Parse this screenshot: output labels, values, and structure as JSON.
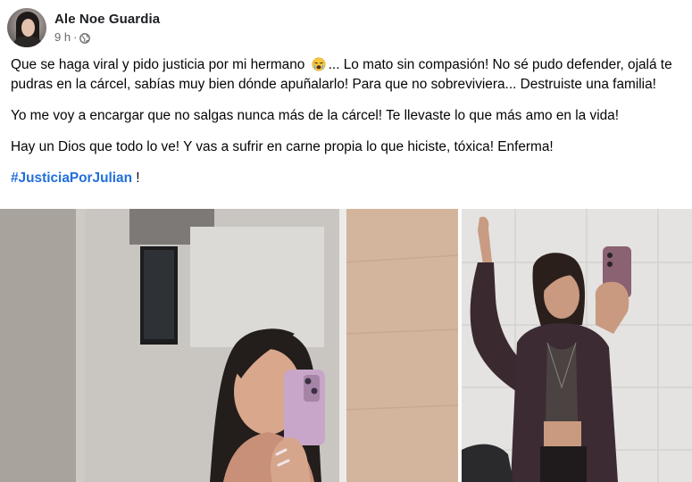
{
  "post": {
    "author": "Ale Noe Guardia",
    "time": "9 h",
    "separator": "·",
    "privacy_icon": "globe-icon",
    "paragraphs": [
      {
        "before_emoji": "Que se haga viral y pido justicia por mi hermano ",
        "emoji": "crying-face-emoji",
        "after_emoji": "... Lo mato sin compasión! No sé pudo defender, ojalá te pudras en la cárcel, sabías muy bien dónde apuñalarlo! Para que no sobreviviera... Destruiste una familia!"
      },
      {
        "text": "Yo me voy a encargar que no salgas nunca más de la cárcel! Te llevaste lo que más amo en la vida!"
      },
      {
        "text": "Hay un Dios que todo lo ve! Y vas a sufrir en carne propia lo que hiciste, tóxica! Enferma!"
      }
    ],
    "hashtag": "#JusticiaPorJulian",
    "hashtag_suffix": " !"
  },
  "colors": {
    "text": "#050505",
    "secondary_text": "#65676b",
    "link": "#216fdb"
  }
}
